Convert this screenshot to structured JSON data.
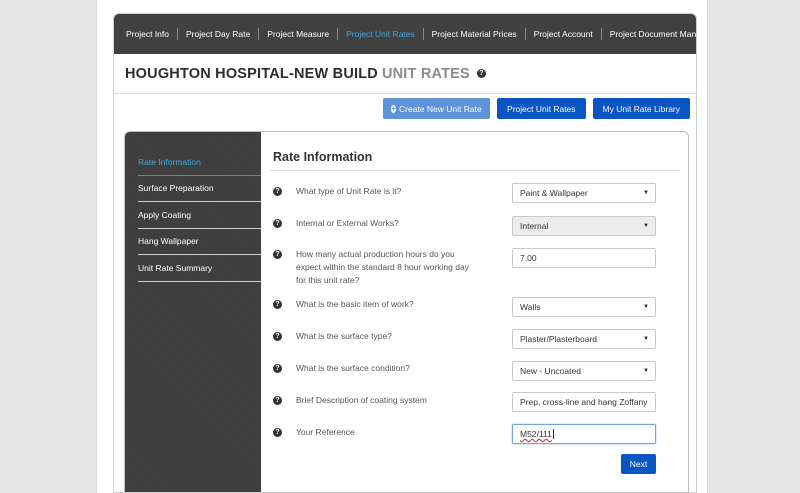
{
  "nav": {
    "items": [
      {
        "label": "Project Info"
      },
      {
        "label": "Project Day Rate"
      },
      {
        "label": "Project Measure"
      },
      {
        "label": "Project Unit Rates"
      },
      {
        "label": "Project Material Prices"
      },
      {
        "label": "Project Account"
      },
      {
        "label": "Project Document Manager"
      }
    ],
    "active_index": 3
  },
  "page": {
    "title": "HOUGHTON HOSPITAL-NEW BUILD",
    "subtitle": "UNIT RATES",
    "help_glyph": "?"
  },
  "actions": {
    "create_label": "Create New Unit Rate",
    "create_icon": "+",
    "project_rates_label": "Project Unit Rates",
    "library_label": "My Unit Rate Library"
  },
  "sidebar": {
    "items": [
      {
        "label": "Rate Information"
      },
      {
        "label": "Surface Preparation"
      },
      {
        "label": "Apply Coating"
      },
      {
        "label": "Hang Wallpaper"
      },
      {
        "label": "Unit Rate Summary"
      }
    ],
    "active_index": 0
  },
  "form": {
    "heading": "Rate Information",
    "questions": [
      {
        "label": "What type of Unit Rate is it?",
        "value": "Paint & Wallpaper",
        "type": "select"
      },
      {
        "label": "Internal or External Works?",
        "value": "Internal",
        "type": "select-disabled"
      },
      {
        "label": "How many actual production hours do you expect within the standard 8 hour working day for this unit rate?",
        "value": "7.00",
        "type": "text"
      },
      {
        "label": "What is the basic item of work?",
        "value": "Walls",
        "type": "select"
      },
      {
        "label": "What is the surface type?",
        "value": "Plaster/Plasterboard",
        "type": "select"
      },
      {
        "label": "What is the surface condition?",
        "value": "New - Uncoated",
        "type": "select"
      },
      {
        "label": "Brief Description of coating system",
        "value": "Prep, cross-line and hang Zoffany",
        "type": "text"
      },
      {
        "label": "Your Reference",
        "value": "M52/111",
        "type": "text-focused"
      }
    ],
    "next_label": "Next"
  },
  "colors": {
    "accent": "#3da8e0",
    "primary_button": "#0a55c4",
    "secondary_button": "#5f93d9",
    "nav_background": "#414141",
    "sidebar_background": "#3c3c3c"
  }
}
